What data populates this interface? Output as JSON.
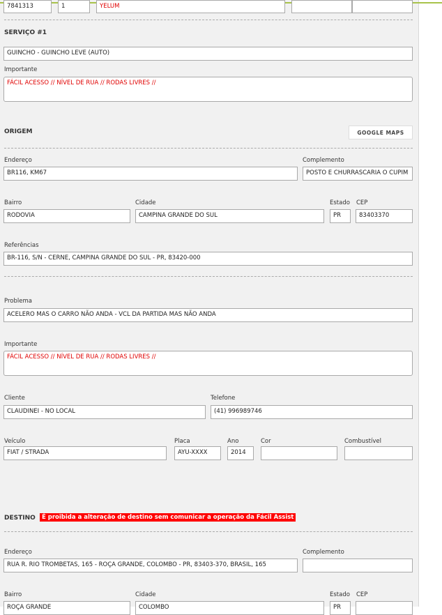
{
  "top": {
    "id": "7841313",
    "qty": "1",
    "color": "YELUM",
    "extra1": "",
    "extra2": ""
  },
  "servico": {
    "title": "SERVIÇO #1",
    "service": "GUINCHO - GUINCHO LEVE (AUTO)",
    "importante_label": "Importante",
    "importante": "FÁCIL ACESSO // NÍVEL DE RUA // RODAS LIVRES //"
  },
  "origem": {
    "title": "ORIGEM",
    "maps_button": "GOOGLE MAPS",
    "endereco_label": "Endereço",
    "endereco": "BR116, KM67",
    "complemento_label": "Complemento",
    "complemento": "POSTO E CHURRASCARIA O CUPIM",
    "bairro_label": "Bairro",
    "bairro": "RODOVIA",
    "cidade_label": "Cidade",
    "cidade": "CAMPINA GRANDE DO SUL",
    "estado_label": "Estado",
    "estado": "PR",
    "cep_label": "CEP",
    "cep": "83403370",
    "referencias_label": "Referências",
    "referencias": "BR-116, S/N - CERNE, CAMPINA GRANDE DO SUL - PR, 83420-000"
  },
  "problema": {
    "label": "Problema",
    "value": "ACELERO MAS O CARRO NÃO ANDA - VCL DA PARTIDA MAS NÃO ANDA",
    "importante_label": "Importante",
    "importante": "FÁCIL ACESSO // NÍVEL DE RUA // RODAS LIVRES //"
  },
  "cliente": {
    "label": "Cliente",
    "value": "CLAUDINEI - NO LOCAL",
    "telefone_label": "Telefone",
    "telefone": "(41) 996989746"
  },
  "veiculo": {
    "label": "Veículo",
    "value": "FIAT / STRADA",
    "placa_label": "Placa",
    "placa": "AYU-XXXX",
    "ano_label": "Ano",
    "ano": "2014",
    "cor_label": "Cor",
    "cor": "",
    "combustivel_label": "Combustível",
    "combustivel": ""
  },
  "destino": {
    "title": "DESTINO",
    "warning": "É proibida a alteração de destino sem comunicar a operação da Fácil Assist",
    "endereco_label": "Endereço",
    "endereco": "RUA R. RIO TROMBETAS, 165 - ROÇA GRANDE, COLOMBO - PR, 83403-370, BRASIL, 165",
    "complemento_label": "Complemento",
    "complemento": "",
    "bairro_label": "Bairro",
    "bairro": "ROÇA GRANDE",
    "cidade_label": "Cidade",
    "cidade": "COLOMBO",
    "estado_label": "Estado",
    "estado": "PR",
    "cep_label": "CEP",
    "cep": ""
  }
}
